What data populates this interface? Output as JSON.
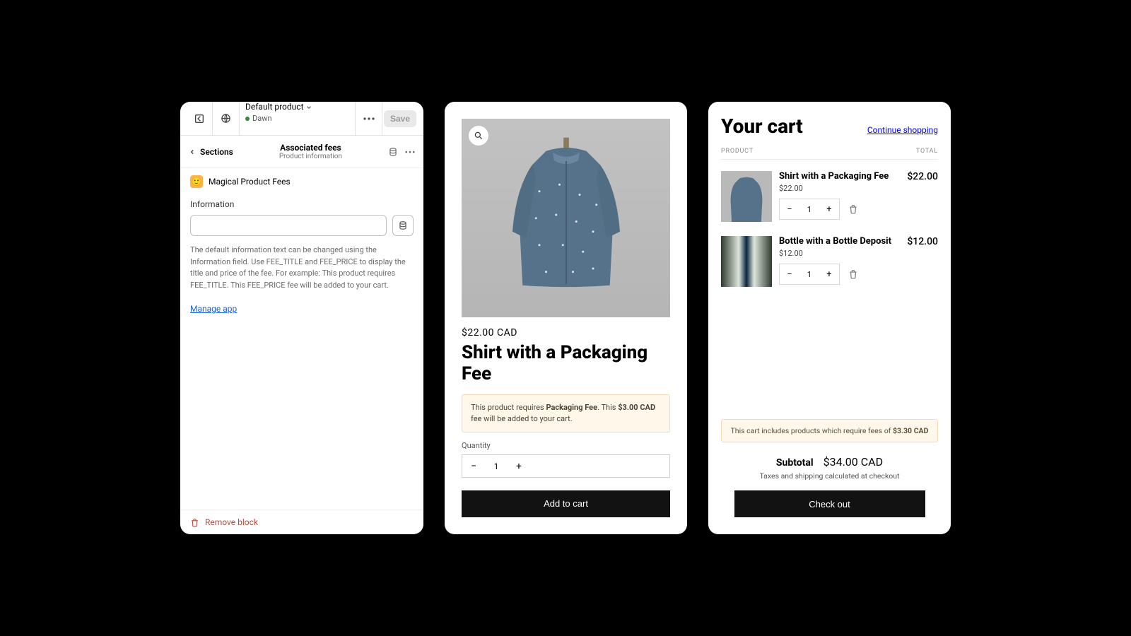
{
  "editor": {
    "template_name": "Default product",
    "theme_name": "Dawn",
    "save_label": "Save",
    "crumb_back": "Sections",
    "crumb_title": "Associated fees",
    "crumb_sub": "Product information",
    "app_name": "Magical Product Fees",
    "field_label": "Information",
    "help_text": "The default information text can be changed using the Information field. Use FEE_TITLE and FEE_PRICE to display the title and price of the fee. For example: This product requires FEE_TITLE. This FEE_PRICE fee will be added to your cart.",
    "manage_app": "Manage app",
    "remove_block": "Remove block"
  },
  "product": {
    "price": "$22.00 CAD",
    "title": "Shirt with a Packaging Fee",
    "fee_pre": "This product requires ",
    "fee_name": "Packaging Fee",
    "fee_mid": ". This ",
    "fee_amount": "$3.00 CAD",
    "fee_post": " fee will be added to your cart.",
    "qty_label": "Quantity",
    "qty": "1",
    "add_to_cart": "Add to cart"
  },
  "cart": {
    "title": "Your cart",
    "continue": "Continue shopping",
    "col_product": "PRODUCT",
    "col_total": "TOTAL",
    "items": [
      {
        "name": "Shirt with a Packaging Fee",
        "price": "$22.00",
        "qty": "1",
        "total": "$22.00"
      },
      {
        "name": "Bottle with a Bottle Deposit",
        "price": "$12.00",
        "qty": "1",
        "total": "$12.00"
      }
    ],
    "fee_note_pre": "This cart includes products which require fees of ",
    "fee_note_amount": "$3.30 CAD",
    "subtotal_label": "Subtotal",
    "subtotal": "$34.00 CAD",
    "shipping_note": "Taxes and shipping calculated at checkout",
    "checkout": "Check out"
  }
}
